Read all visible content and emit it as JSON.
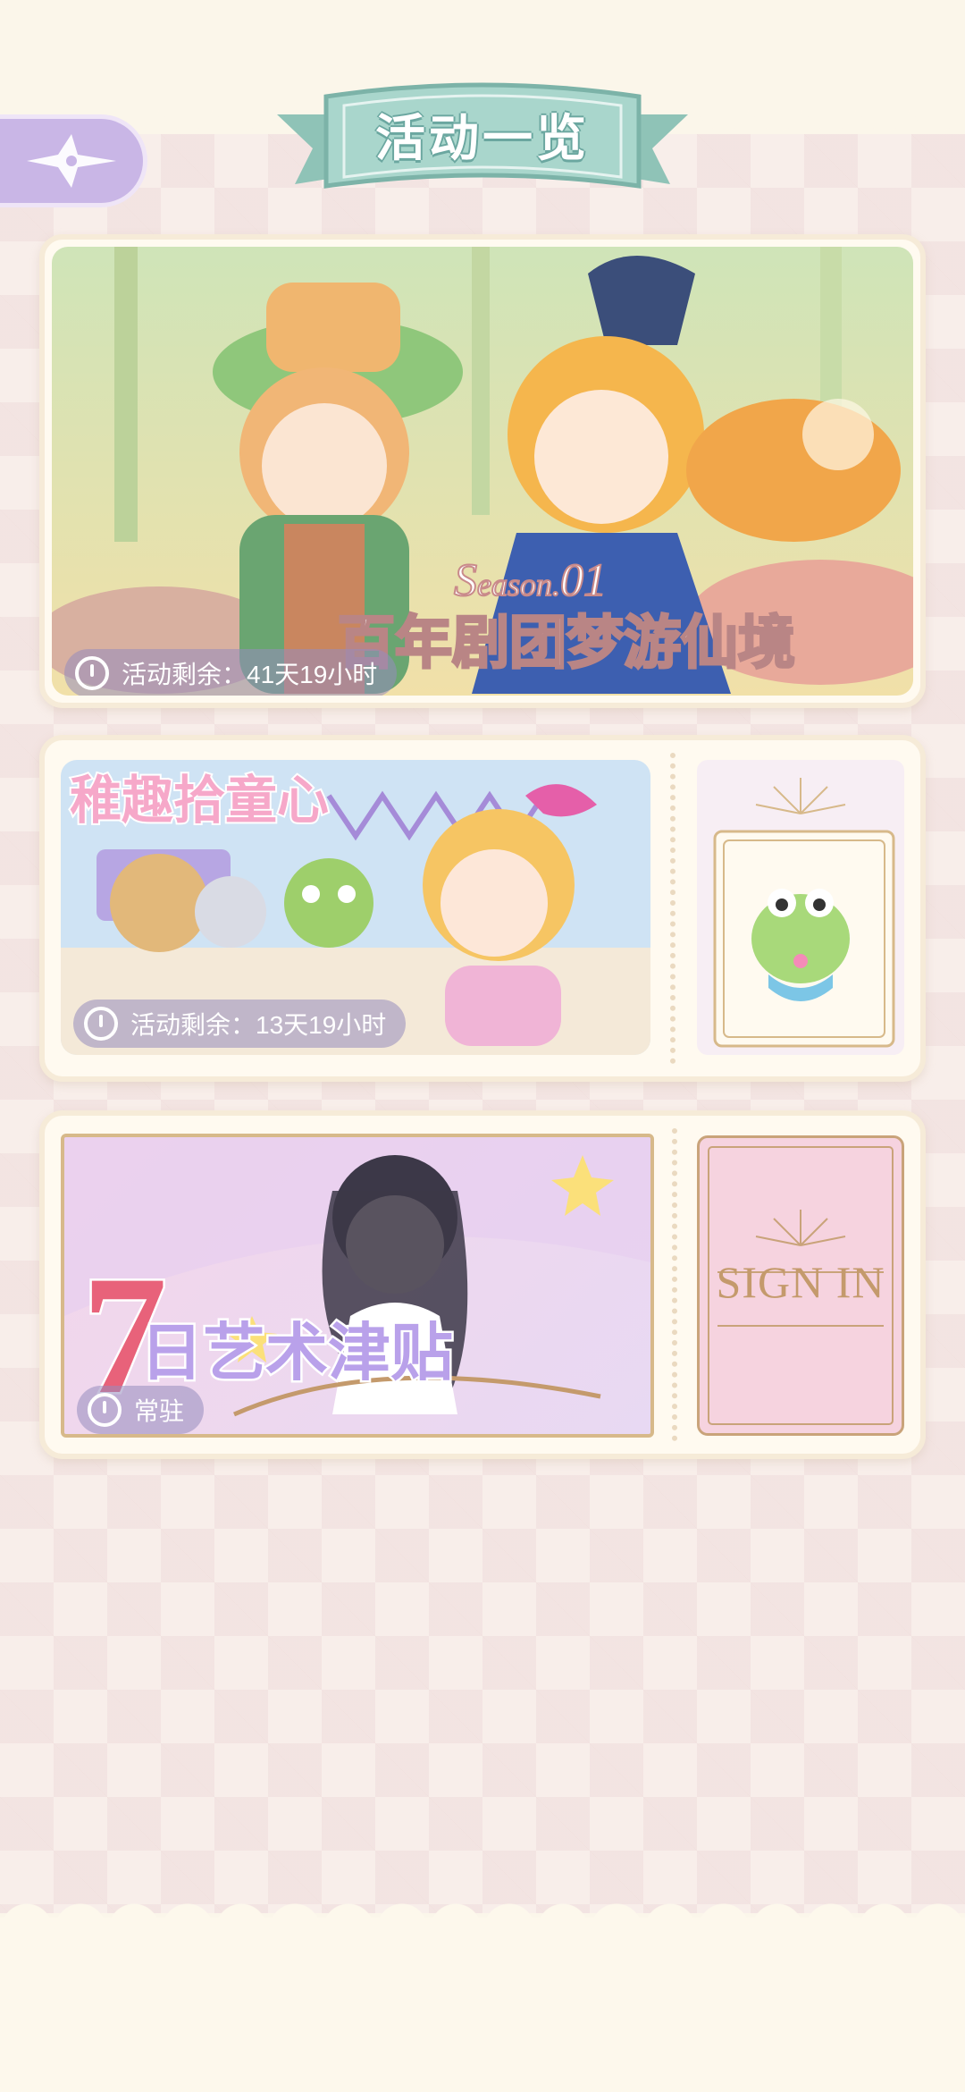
{
  "header": {
    "title": "活动一览",
    "back_icon": "compass-star-icon"
  },
  "events": [
    {
      "id_label": "card-1",
      "art_title_season": "Season.01",
      "art_title": "百年剧团梦游仙境",
      "countdown": "活动剩余：41天19小时",
      "clock_icon": "clock-icon"
    },
    {
      "id_label": "card-2",
      "art_title": "稚趣拾童心",
      "countdown": "活动剩余：13天19小时",
      "clock_icon": "clock-icon"
    },
    {
      "id_label": "card-3",
      "art_title_num": "7",
      "art_title": "日艺术津贴",
      "countdown": "常驻",
      "stub_text": "SIGN IN",
      "clock_icon": "clock-icon"
    }
  ],
  "colors": {
    "page_bg": "#fbf6ea",
    "ribbon": "#9fcfc4",
    "back_button": "#c9b6e6",
    "badge": "#968cbe",
    "sign_in_gold": "#c49a6c"
  }
}
